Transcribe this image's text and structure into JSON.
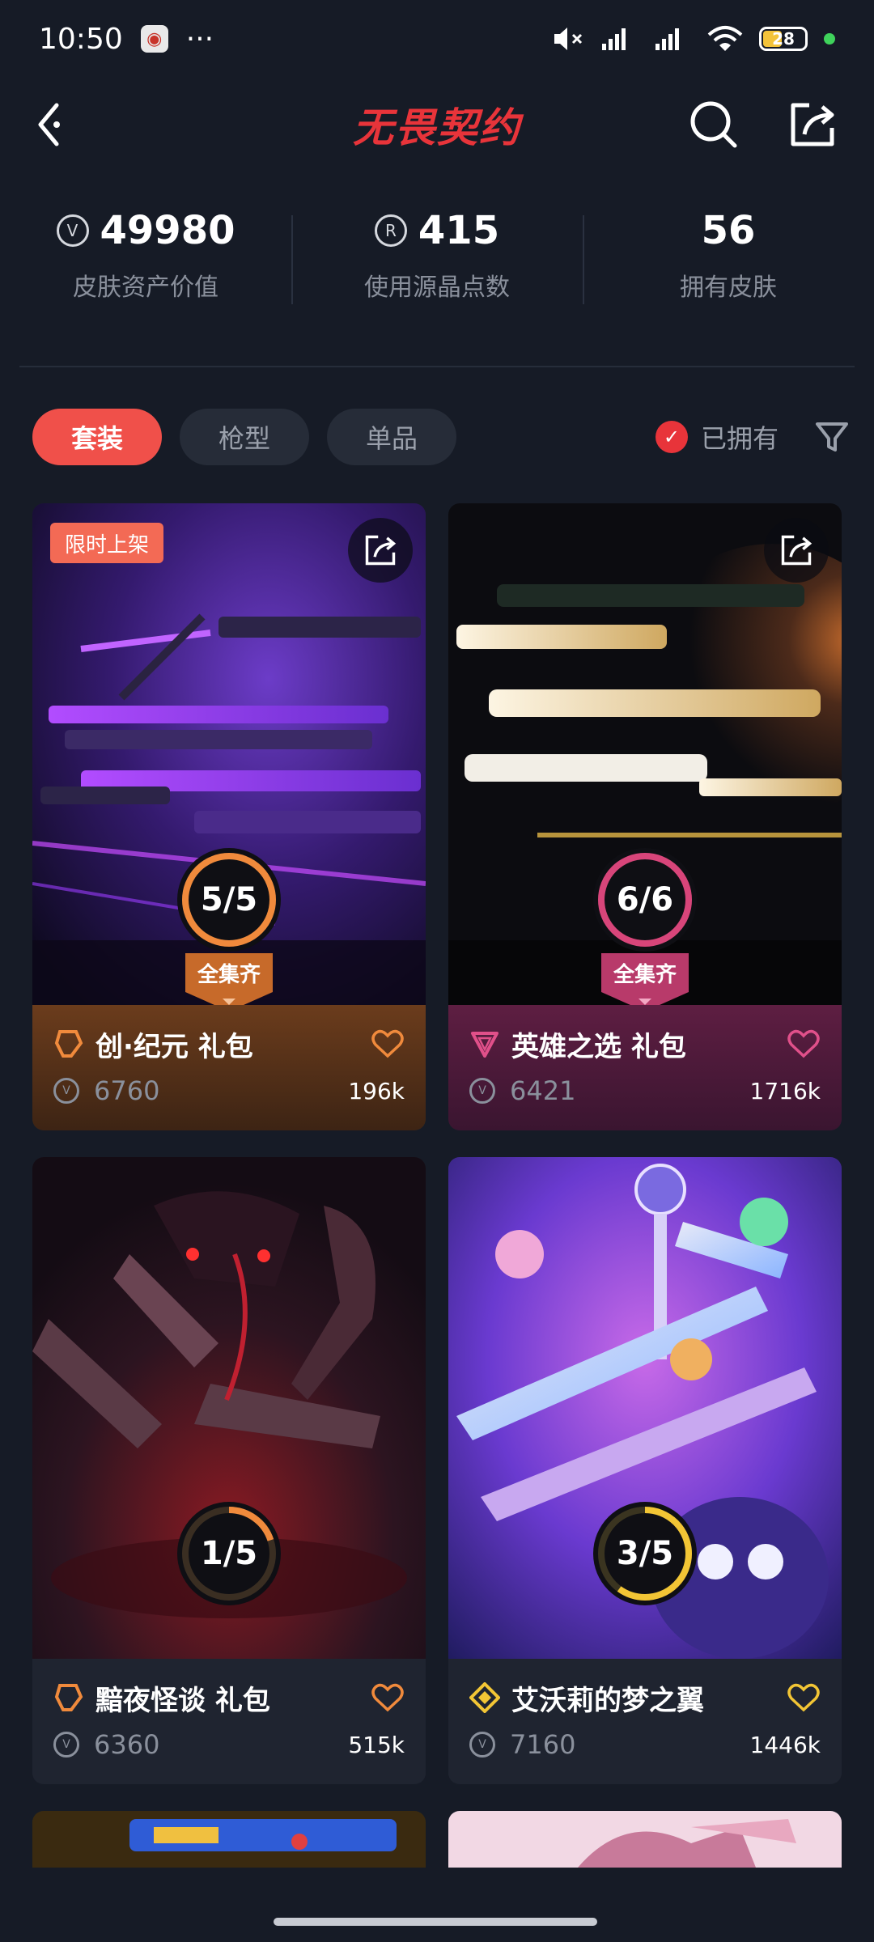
{
  "status": {
    "time": "10:50",
    "more": "···",
    "battery": "28",
    "mute_icon": "mute-icon",
    "signal_icon": "signal-icon",
    "wifi_icon": "wifi-icon"
  },
  "header": {
    "title": "无畏契约",
    "back_icon": "back-arrow-icon",
    "search_icon": "search-icon",
    "share_icon": "share-icon"
  },
  "stats": [
    {
      "value": "49980",
      "label": "皮肤资产价值",
      "icon": "vp-coin-icon"
    },
    {
      "value": "415",
      "label": "使用源晶点数",
      "icon": "radianite-icon"
    },
    {
      "value": "56",
      "label": "拥有皮肤"
    }
  ],
  "filters": {
    "tabs": [
      "套装",
      "枪型",
      "单品"
    ],
    "active_tab": "套装",
    "owned_label": "已拥有",
    "owned_checked": true,
    "filter_icon": "filter-icon"
  },
  "colors": {
    "accent": "#f0504a",
    "title_red": "#e8343a",
    "background": "#161b26",
    "orange_tier": "#f08a3c",
    "pink_tier": "#d8457a",
    "gold_tier": "#f2c535"
  },
  "cards": [
    {
      "name": "创·纪元 礼包",
      "price": "6760",
      "likes": "196k",
      "progress": "5/5",
      "progress_fraction": 1.0,
      "complete_label": "全集齐",
      "limited_label": "限时上架",
      "tier_icon": "premium-tier-icon"
    },
    {
      "name": "英雄之选 礼包",
      "price": "6421",
      "likes": "1716k",
      "progress": "6/6",
      "progress_fraction": 1.0,
      "complete_label": "全集齐",
      "tier_icon": "exclusive-tier-icon"
    },
    {
      "name": "黯夜怪谈 礼包",
      "price": "6360",
      "likes": "515k",
      "progress": "1/5",
      "progress_fraction": 0.2,
      "tier_icon": "premium-tier-icon"
    },
    {
      "name": "艾沃莉的梦之翼",
      "price": "7160",
      "likes": "1446k",
      "progress": "3/5",
      "progress_fraction": 0.6,
      "tier_icon": "ultra-tier-icon"
    }
  ]
}
